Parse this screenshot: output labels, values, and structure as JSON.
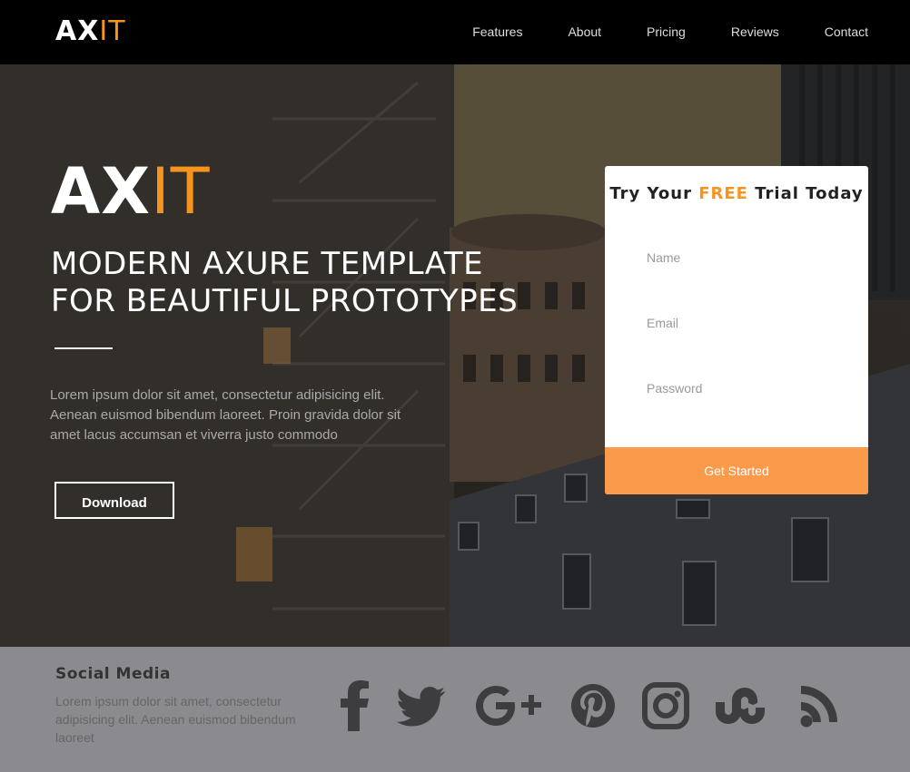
{
  "brand": {
    "logo_main": "AX",
    "logo_accent": "IT",
    "accent_color": "#f7941d"
  },
  "nav": {
    "links": [
      "Features",
      "About",
      "Pricing",
      "Reviews",
      "Contact"
    ]
  },
  "hero": {
    "logo_main": "AX",
    "logo_accent": "IT",
    "headline_line1": "MODERN AXURE TEMPLATE",
    "headline_line2": "FOR BEAUTIFUL PROTOTYPES",
    "description": "Lorem ipsum dolor sit amet, consectetur adipisicing elit. Aenean euismod bibendum laoreet. Proin gravida dolor sit amet lacus accumsan et viverra justo commodo",
    "download_label": "Download"
  },
  "form": {
    "title_pre": "Try Your ",
    "title_free": "FREE",
    "title_post": " Trial Today",
    "name_placeholder": "Name",
    "email_placeholder": "Email",
    "password_placeholder": "Password",
    "submit_label": "Get Started",
    "button_color": "#fb9a4b"
  },
  "footer": {
    "title": "Social Media",
    "text": "Lorem ipsum dolor sit amet, consectetur adipisicing elit. Aenean euismod bibendum laoreet",
    "social_icons": [
      "facebook-icon",
      "twitter-icon",
      "google-plus-icon",
      "pinterest-icon",
      "instagram-icon",
      "stumbleupon-icon",
      "rss-icon"
    ]
  }
}
